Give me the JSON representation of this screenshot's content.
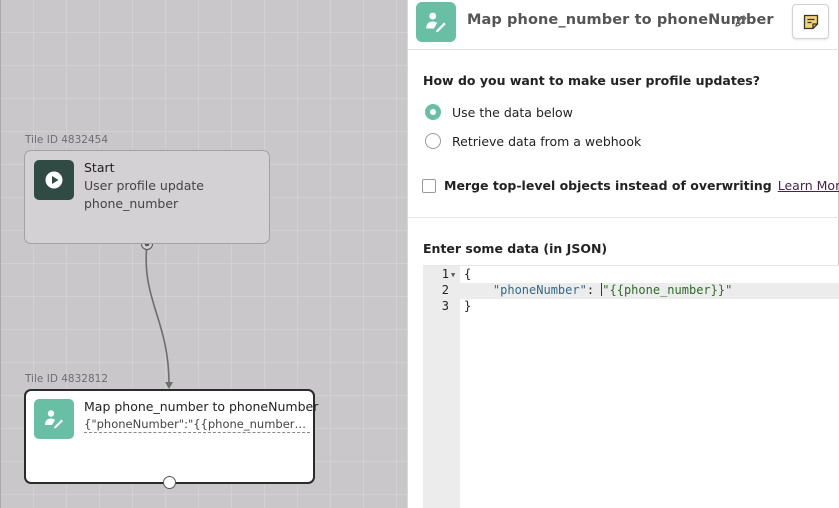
{
  "canvas": {
    "tiles": [
      {
        "tile_id_label": "Tile ID 4832454",
        "title": "Start",
        "subtitle_1": "User profile update",
        "subtitle_2": "phone_number",
        "icon": "play-icon"
      },
      {
        "tile_id_label": "Tile ID 4832812",
        "title": "Map phone_number to phoneNumber",
        "preview": "{\"phoneNumber\":\"{{phone_number}}\"}",
        "icon": "user-edit-icon"
      }
    ]
  },
  "panel": {
    "header": {
      "title": "Map phone_number to phoneNumber",
      "icon": "user-edit-icon",
      "edit_icon": "pencil-icon",
      "notes_icon": "sticky-note-icon"
    },
    "question": "How do you want to make user profile updates?",
    "options": [
      {
        "label": "Use the data below",
        "checked": true
      },
      {
        "label": "Retrieve data from a webhook",
        "checked": false
      }
    ],
    "merge": {
      "label": "Merge top-level objects instead of overwriting",
      "checked": false,
      "link_label": "Learn More",
      "link_icon": "external-link-icon"
    },
    "json_label": "Enter some data (in JSON)",
    "editor": {
      "lines": [
        {
          "number": "1",
          "open": "{"
        },
        {
          "number": "2",
          "indent": "    ",
          "key": "\"phoneNumber\"",
          "colon": ": ",
          "value": "\"{{phone_number}}\""
        },
        {
          "number": "3",
          "close": "}"
        }
      ]
    }
  },
  "colors": {
    "accent_teal": "#69bfa3",
    "start_icon_bg": "#2f4b43",
    "canvas_bg": "#cac7cb",
    "link_purple": "#4a2152"
  }
}
